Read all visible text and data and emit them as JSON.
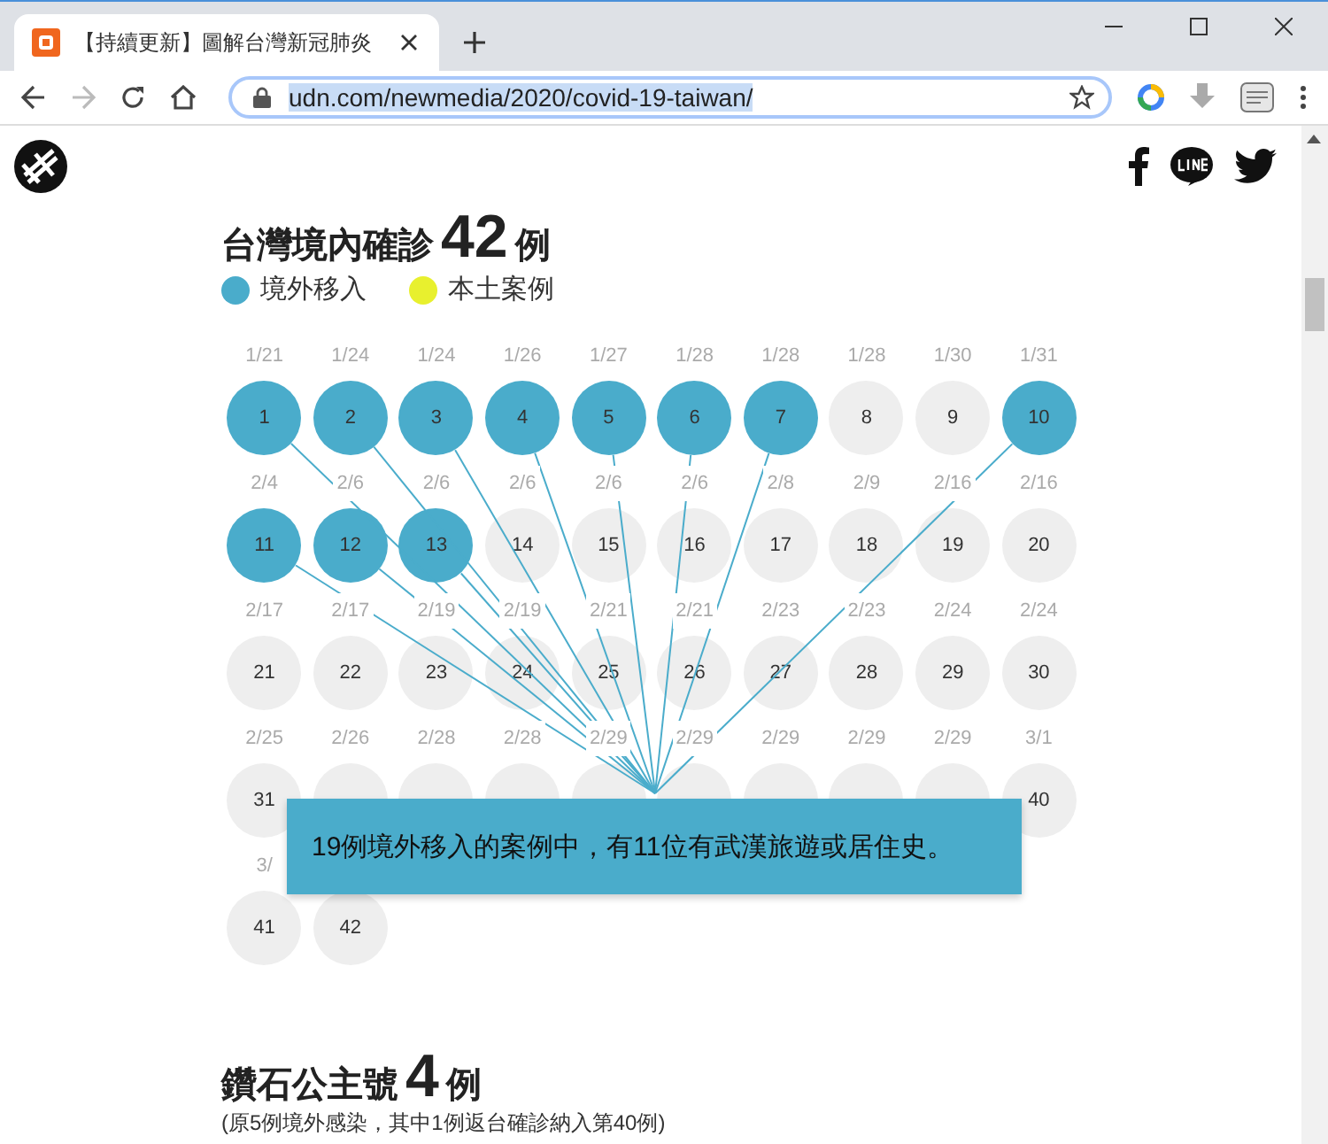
{
  "browser": {
    "tab_title": "【持續更新】圖解台灣新冠肺炎",
    "address": "udn.com/newmedia/2020/covid-19-taiwan/"
  },
  "title": {
    "text": "台灣境內確診",
    "count": "42",
    "unit": "例"
  },
  "legend": [
    {
      "label": "境外移入",
      "color": "#4aaccb"
    },
    {
      "label": "本土案例",
      "color": "#e8f02e"
    }
  ],
  "cases": [
    {
      "date": "1/21",
      "number": "1",
      "kind": "imported"
    },
    {
      "date": "1/24",
      "number": "2",
      "kind": "imported"
    },
    {
      "date": "1/24",
      "number": "3",
      "kind": "imported"
    },
    {
      "date": "1/26",
      "number": "4",
      "kind": "imported"
    },
    {
      "date": "1/27",
      "number": "5",
      "kind": "imported"
    },
    {
      "date": "1/28",
      "number": "6",
      "kind": "imported"
    },
    {
      "date": "1/28",
      "number": "7",
      "kind": "imported"
    },
    {
      "date": "1/28",
      "number": "8",
      "kind": "other"
    },
    {
      "date": "1/30",
      "number": "9",
      "kind": "other"
    },
    {
      "date": "1/31",
      "number": "10",
      "kind": "imported"
    },
    {
      "date": "2/4",
      "number": "11",
      "kind": "imported"
    },
    {
      "date": "2/6",
      "number": "12",
      "kind": "imported"
    },
    {
      "date": "2/6",
      "number": "13",
      "kind": "imported"
    },
    {
      "date": "2/6",
      "number": "14",
      "kind": "other"
    },
    {
      "date": "2/6",
      "number": "15",
      "kind": "other"
    },
    {
      "date": "2/6",
      "number": "16",
      "kind": "other"
    },
    {
      "date": "2/8",
      "number": "17",
      "kind": "other"
    },
    {
      "date": "2/9",
      "number": "18",
      "kind": "other"
    },
    {
      "date": "2/16",
      "number": "19",
      "kind": "other"
    },
    {
      "date": "2/16",
      "number": "20",
      "kind": "other"
    },
    {
      "date": "2/17",
      "number": "21",
      "kind": "other"
    },
    {
      "date": "2/17",
      "number": "22",
      "kind": "other"
    },
    {
      "date": "2/19",
      "number": "23",
      "kind": "other"
    },
    {
      "date": "2/19",
      "number": "24",
      "kind": "other"
    },
    {
      "date": "2/21",
      "number": "25",
      "kind": "other"
    },
    {
      "date": "2/21",
      "number": "26",
      "kind": "other"
    },
    {
      "date": "2/23",
      "number": "27",
      "kind": "other"
    },
    {
      "date": "2/23",
      "number": "28",
      "kind": "other"
    },
    {
      "date": "2/24",
      "number": "29",
      "kind": "other"
    },
    {
      "date": "2/24",
      "number": "30",
      "kind": "other"
    },
    {
      "date": "2/25",
      "number": "31",
      "kind": "other"
    },
    {
      "date": "2/26",
      "kind": "other"
    },
    {
      "date": "2/28",
      "kind": "other"
    },
    {
      "date": "2/28",
      "kind": "other"
    },
    {
      "date": "2/29",
      "kind": "other"
    },
    {
      "date": "2/29",
      "kind": "other"
    },
    {
      "date": "2/29",
      "kind": "other"
    },
    {
      "date": "2/29",
      "kind": "other"
    },
    {
      "date": "2/29",
      "kind": "other"
    },
    {
      "date": "3/1",
      "number": "40",
      "kind": "other"
    },
    {
      "date": "3/",
      "number": "41",
      "kind": "other"
    },
    {
      "number": "42",
      "kind": "other"
    }
  ],
  "callout": "19例境外移入的案例中，有11位有武漢旅遊或居住史。",
  "section2": {
    "title": "鑽石公主號",
    "count": "4",
    "unit": "例",
    "note": "(原5例境外感染，其中1例返台確診納入第40例)"
  }
}
